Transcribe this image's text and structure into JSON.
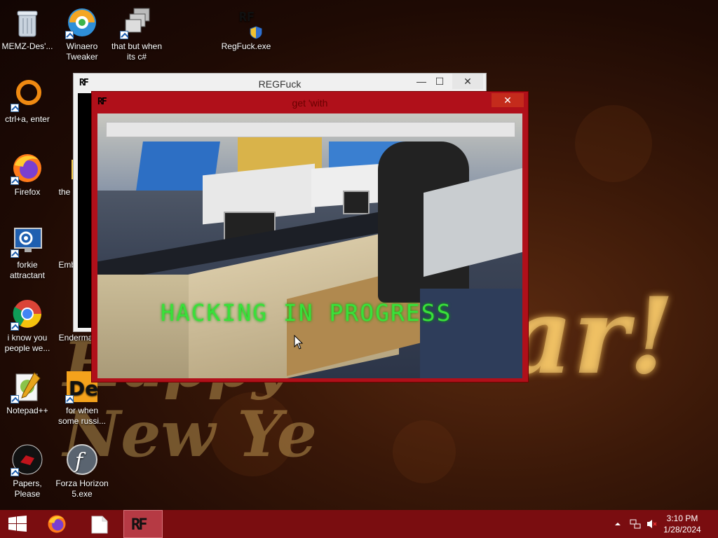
{
  "desktop": {
    "icons": [
      {
        "label": "MEMZ-Des'...",
        "icon": "recycle-bin-icon"
      },
      {
        "label": "Winaero Tweaker",
        "icon": "winaero-icon"
      },
      {
        "label": "that but when its c#",
        "icon": "windows-stack-icon"
      },
      {
        "label": "RegFuck.exe",
        "icon": "regfuck-exe-icon"
      },
      {
        "label": "ctrl+a, enter",
        "icon": "orange-ring-icon"
      },
      {
        "label": "Firefox",
        "icon": "firefox-icon"
      },
      {
        "label": "the",
        "icon": "folder-icon"
      },
      {
        "label": "forkie attractant",
        "icon": "settings-monitor-icon"
      },
      {
        "label": "Emb De",
        "icon": "red-app-icon"
      },
      {
        "label": "i know you people we...",
        "icon": "chrome-icon"
      },
      {
        "label": "Enderma",
        "icon": "app-icon"
      },
      {
        "label": "Notepad++",
        "icon": "notepadpp-icon"
      },
      {
        "label": "for when some russi...",
        "icon": "de-icon"
      },
      {
        "label": "Papers, Please",
        "icon": "papers-please-icon"
      },
      {
        "label": "Forza Horizon 5.exe",
        "icon": "flash-icon"
      }
    ],
    "wallpaper_text": "ar!",
    "accent": "#b0101a"
  },
  "windows": {
    "back": {
      "title": "REGFuck",
      "minimize": "—",
      "maximize": "☐",
      "close": "✕"
    },
    "front": {
      "title": "get 'with",
      "close": "✕",
      "overlay_text": "HACKING IN PROGRESS"
    }
  },
  "taskbar": {
    "start_icon": "windows-start-icon",
    "pinned": [
      "firefox-icon",
      "file-icon",
      "regfuck-icon"
    ],
    "clock_time": "3:10 PM",
    "clock_date": "1/28/2024"
  }
}
